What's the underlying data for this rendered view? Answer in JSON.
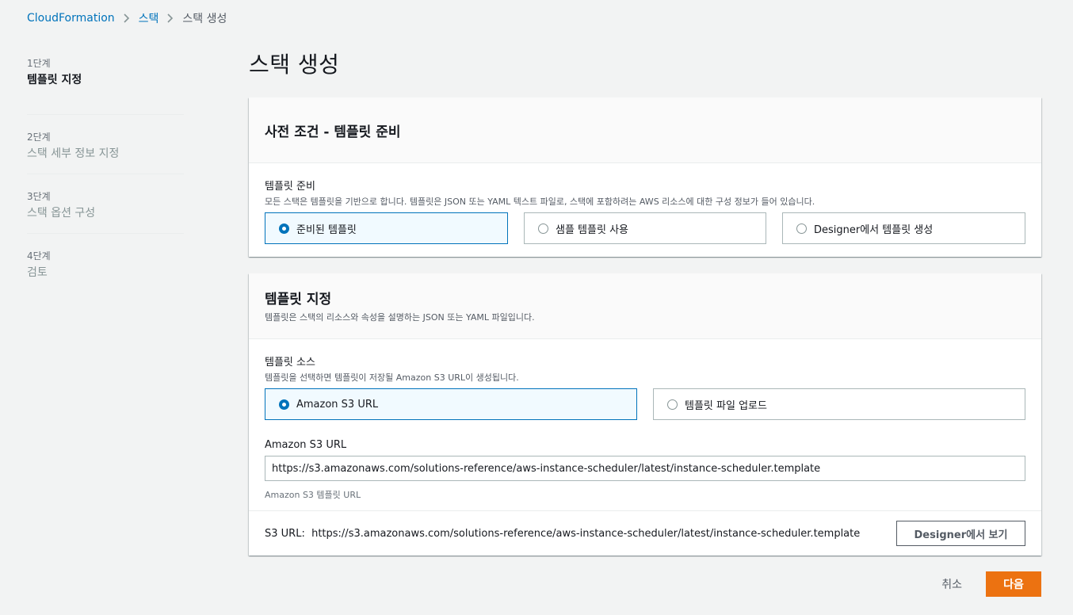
{
  "breadcrumb": {
    "items": [
      "CloudFormation",
      "스택",
      "스택 생성"
    ]
  },
  "steps": [
    {
      "num": "1단계",
      "title": "템플릿 지정",
      "active": true
    },
    {
      "num": "2단계",
      "title": "스택 세부 정보 지정",
      "active": false
    },
    {
      "num": "3단계",
      "title": "스택 옵션 구성",
      "active": false
    },
    {
      "num": "4단계",
      "title": "검토",
      "active": false
    }
  ],
  "page_title": "스택 생성",
  "prereq_panel": {
    "header": "사전 조건 - 템플릿 준비",
    "field_label": "템플릿 준비",
    "field_desc": "모든 스택은 템플릿을 기반으로 합니다. 템플릿은 JSON 또는 YAML 텍스트 파일로, 스택에 포함하려는 AWS 리소스에 대한 구성 정보가 들어 있습니다.",
    "options": [
      {
        "label": "준비된 템플릿",
        "selected": true
      },
      {
        "label": "샘플 템플릿 사용",
        "selected": false
      },
      {
        "label": "Designer에서 템플릿 생성",
        "selected": false
      }
    ]
  },
  "template_panel": {
    "header": "템플릿 지정",
    "header_desc": "템플릿은 스택의 리소스와 속성을 설명하는 JSON 또는 YAML 파일입니다.",
    "source_label": "템플릿 소스",
    "source_desc": "템플릿을 선택하면 템플릿이 저장될 Amazon S3 URL이 생성됩니다.",
    "source_options": [
      {
        "label": "Amazon S3 URL",
        "selected": true
      },
      {
        "label": "템플릿 파일 업로드",
        "selected": false
      }
    ],
    "url_label": "Amazon S3 URL",
    "url_value": "https://s3.amazonaws.com/solutions-reference/aws-instance-scheduler/latest/instance-scheduler.template",
    "url_hint": "Amazon S3 템플릿 URL",
    "s3_url_label": "S3 URL:",
    "s3_url_value": "https://s3.amazonaws.com/solutions-reference/aws-instance-scheduler/latest/instance-scheduler.template",
    "designer_button": "Designer에서 보기"
  },
  "actions": {
    "cancel": "취소",
    "next": "다음"
  },
  "colors": {
    "accent": "#0073bb",
    "primary_button": "#ec7211",
    "background": "#f2f3f3"
  }
}
